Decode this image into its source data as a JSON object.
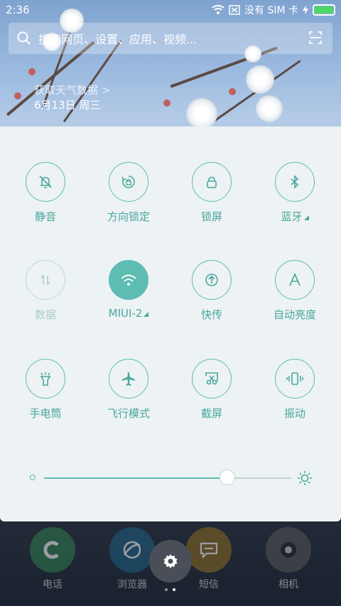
{
  "status_bar": {
    "time": "2:36",
    "carrier": "没有 SIM 卡"
  },
  "search": {
    "placeholder": "搜索网页、设置、应用、视频..."
  },
  "weather": {
    "link": "获取天气数据 >",
    "date": "6月13日 周三"
  },
  "toggles": [
    {
      "label": "静音",
      "icon": "bell-off-icon",
      "state": "inactive"
    },
    {
      "label": "方向锁定",
      "icon": "rotation-lock-icon",
      "state": "inactive"
    },
    {
      "label": "锁屏",
      "icon": "lock-icon",
      "state": "inactive"
    },
    {
      "label": "蓝牙",
      "icon": "bluetooth-icon",
      "state": "inactive"
    },
    {
      "label": "数据",
      "icon": "data-icon",
      "state": "disabled"
    },
    {
      "label": "MIUI-2",
      "icon": "wifi-icon",
      "state": "active"
    },
    {
      "label": "快传",
      "icon": "share-icon",
      "state": "inactive"
    },
    {
      "label": "自动亮度",
      "icon": "auto-brightness-icon",
      "state": "inactive"
    },
    {
      "label": "手电筒",
      "icon": "flashlight-icon",
      "state": "inactive"
    },
    {
      "label": "飞行模式",
      "icon": "airplane-icon",
      "state": "inactive"
    },
    {
      "label": "截屏",
      "icon": "screenshot-icon",
      "state": "inactive"
    },
    {
      "label": "振动",
      "icon": "vibrate-icon",
      "state": "inactive"
    }
  ],
  "brightness": {
    "level": 0.74
  },
  "dock": [
    {
      "label": "电话",
      "color": "#2e7d4f"
    },
    {
      "label": "浏览器",
      "color": "#1f5f82"
    },
    {
      "label": "短信",
      "color": "#8a6a1e"
    },
    {
      "label": "相机",
      "color": "#555555"
    }
  ],
  "colors": {
    "accent": "#5dbdb2",
    "panel": "#edf2f4"
  }
}
